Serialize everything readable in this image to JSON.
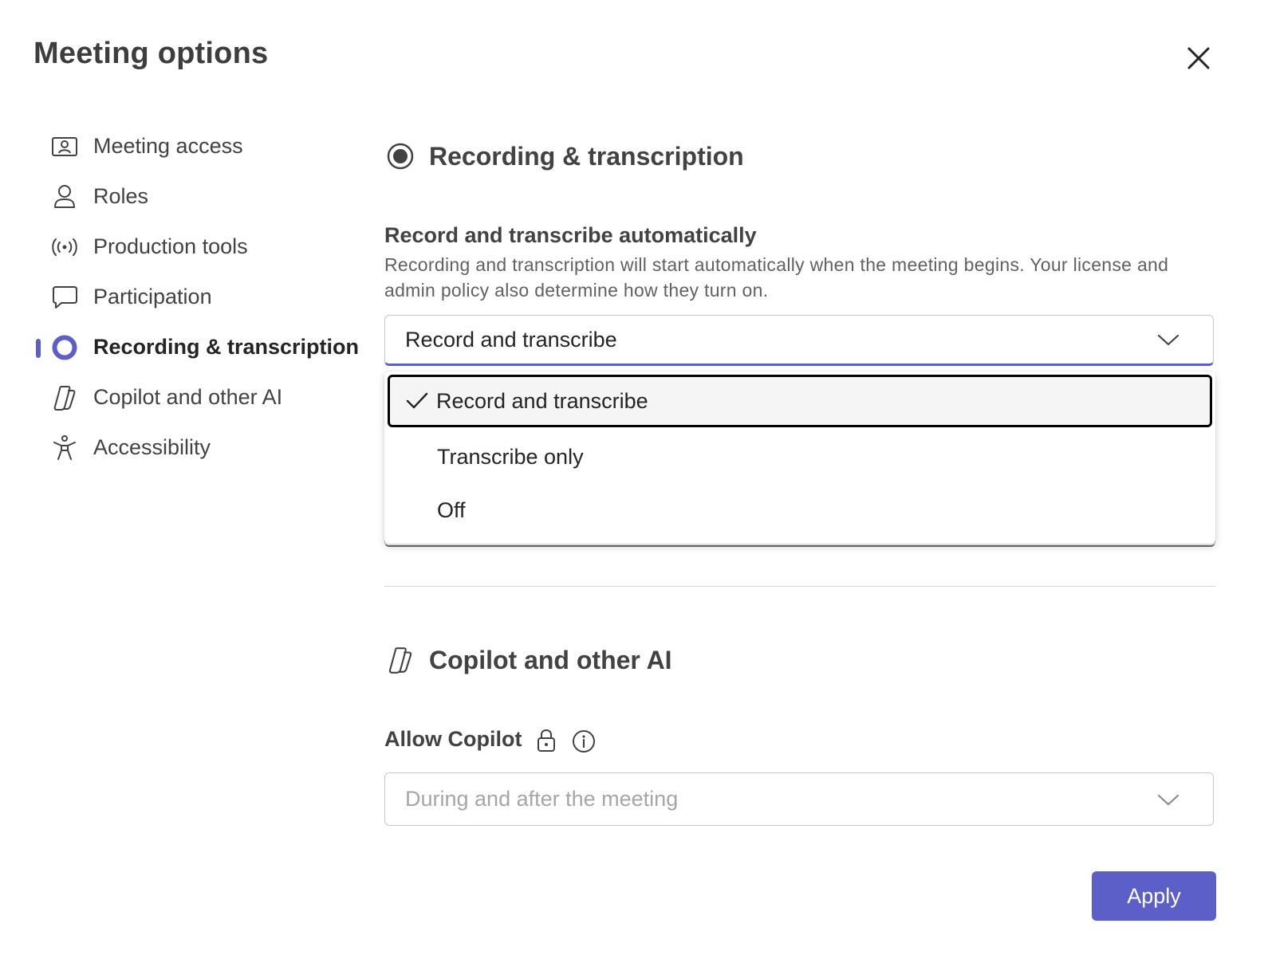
{
  "dialog": {
    "title": "Meeting options",
    "close_icon": "close-icon"
  },
  "sidebar": {
    "items": [
      {
        "label": "Meeting access",
        "icon": "person-card-icon",
        "active": false
      },
      {
        "label": "Roles",
        "icon": "person-icon",
        "active": false
      },
      {
        "label": "Production tools",
        "icon": "broadcast-icon",
        "active": false
      },
      {
        "label": "Participation",
        "icon": "chat-icon",
        "active": false
      },
      {
        "label": "Recording & transcription",
        "icon": "record-icon",
        "active": true
      },
      {
        "label": "Copilot and other AI",
        "icon": "copilot-icon",
        "active": false
      },
      {
        "label": "Accessibility",
        "icon": "accessibility-icon",
        "active": false
      }
    ],
    "accent_color": "#5b5fc7"
  },
  "recording_section": {
    "title": "Recording & transcription",
    "field_label": "Record and transcribe automatically",
    "description": "Recording and transcription will start automatically when the meeting begins. Your license and admin policy also determine how they turn on.",
    "select_value": "Record and transcribe",
    "dropdown_open": true,
    "options": [
      {
        "label": "Record and transcribe",
        "selected": true
      },
      {
        "label": "Transcribe only",
        "selected": false
      },
      {
        "label": "Off",
        "selected": false
      }
    ]
  },
  "copilot_section": {
    "title": "Copilot and other AI",
    "field_label": "Allow Copilot",
    "select_value": "During and after the meeting",
    "disabled": true,
    "icons": [
      "lock-icon",
      "info-icon"
    ]
  },
  "footer": {
    "apply_label": "Apply",
    "apply_color": "#5b5fc7"
  }
}
